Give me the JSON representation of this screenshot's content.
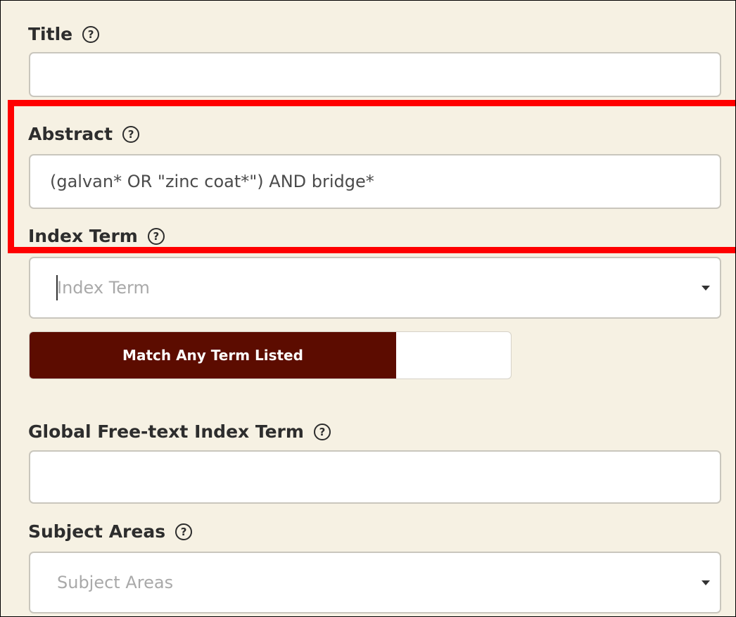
{
  "fields": {
    "title": {
      "label": "Title",
      "value": ""
    },
    "abstract": {
      "label": "Abstract",
      "value": "(galvan* OR \"zinc coat*\") AND bridge*"
    },
    "index_term": {
      "label": "Index Term",
      "placeholder": "Index Term"
    },
    "match_toggle": {
      "label": "Match Any Term Listed",
      "state": "on"
    },
    "global_free_text": {
      "label": "Global Free-text Index Term",
      "value": ""
    },
    "subject_areas": {
      "label": "Subject Areas",
      "placeholder": "Subject Areas"
    }
  },
  "help_icon_glyph": "?",
  "colors": {
    "background": "#f6f1e3",
    "toggle_active": "#5c0c00",
    "highlight_box": "#ff0000"
  },
  "icons": {
    "help": "help-circle-icon",
    "dropdown": "chevron-down-icon"
  }
}
